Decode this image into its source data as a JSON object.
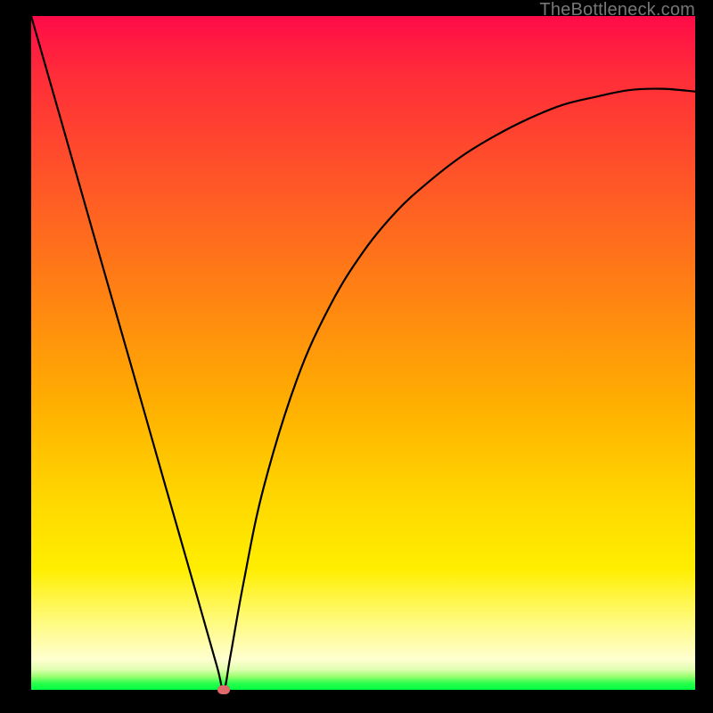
{
  "watermark": "TheBottleneck.com",
  "chart_data": {
    "type": "line",
    "title": "",
    "xlabel": "",
    "ylabel": "",
    "xlim": [
      0,
      1
    ],
    "ylim": [
      0,
      1
    ],
    "grid": false,
    "legend": false,
    "background_gradient": {
      "direction": "vertical",
      "stops": [
        {
          "pos": 0.0,
          "color": "#ff0b48"
        },
        {
          "pos": 0.25,
          "color": "#ff5727"
        },
        {
          "pos": 0.58,
          "color": "#ffb000"
        },
        {
          "pos": 0.82,
          "color": "#ffee00"
        },
        {
          "pos": 0.95,
          "color": "#ffffd0"
        },
        {
          "pos": 1.0,
          "color": "#00ff41"
        }
      ]
    },
    "series": [
      {
        "name": "bottleneck-curve",
        "color": "#000000",
        "x": [
          0.0,
          0.05,
          0.1,
          0.15,
          0.2,
          0.25,
          0.28,
          0.29,
          0.3,
          0.32,
          0.35,
          0.4,
          0.45,
          0.5,
          0.55,
          0.6,
          0.65,
          0.7,
          0.75,
          0.8,
          0.85,
          0.9,
          0.95,
          1.0
        ],
        "y": [
          1.0,
          0.828,
          0.655,
          0.483,
          0.31,
          0.138,
          0.034,
          0.0,
          0.05,
          0.16,
          0.3,
          0.46,
          0.57,
          0.65,
          0.71,
          0.755,
          0.793,
          0.823,
          0.848,
          0.868,
          0.88,
          0.89,
          0.892,
          0.888
        ]
      }
    ],
    "markers": [
      {
        "name": "min-point",
        "x": 0.29,
        "y": 0.0,
        "color": "#e06a6a"
      }
    ]
  }
}
